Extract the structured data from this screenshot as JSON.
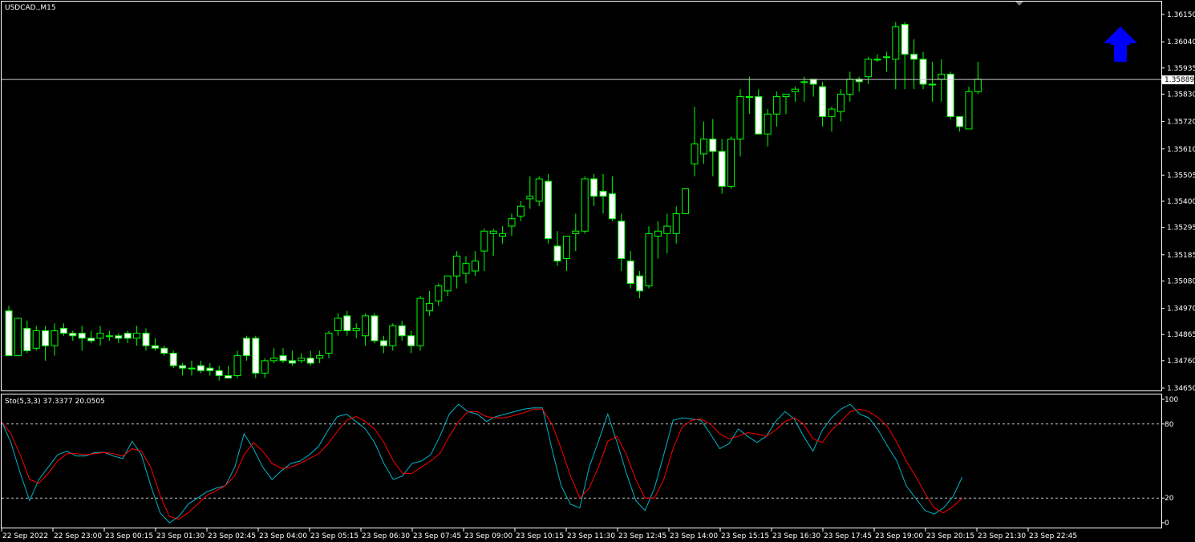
{
  "symbol_label": "USDCAD.,M15",
  "indicator_label": "Sto(5,3,3) 37.3377 20.0505",
  "arrow": {
    "name": "up-arrow-icon",
    "color": "#0000ff"
  },
  "colors": {
    "background": "#000000",
    "candle_outline": "#00ff00",
    "bull_body": "#000000",
    "bear_body": "#ffffff",
    "main_line": "#00b4c8",
    "signal_line": "#ff0000",
    "level_line": "#c0c0c0",
    "frame": "#ffffff"
  },
  "chart_data": [
    {
      "type": "candlestick",
      "title": "USDCAD.,M15",
      "ylim": [
        1.346,
        1.362
      ],
      "y_ticks": [
        "1.36150",
        "1.36040",
        "1.35935",
        "1.35830",
        "1.35720",
        "1.35610",
        "1.35505",
        "1.35400",
        "1.35295",
        "1.35185",
        "1.35080",
        "1.34970",
        "1.34865",
        "1.34760",
        "1.34650"
      ],
      "current_price": "1.35889",
      "current_price_value": 1.35889,
      "x_ticks": [
        "22 Sep 2022",
        "22 Sep 23:00",
        "23 Sep 00:15",
        "23 Sep 01:30",
        "23 Sep 02:45",
        "23 Sep 04:00",
        "23 Sep 05:15",
        "23 Sep 06:30",
        "23 Sep 07:45",
        "23 Sep 09:00",
        "23 Sep 10:15",
        "23 Sep 11:30",
        "23 Sep 12:45",
        "23 Sep 14:00",
        "23 Sep 15:15",
        "23 Sep 16:30",
        "23 Sep 17:45",
        "23 Sep 19:00",
        "23 Sep 20:15",
        "23 Sep 21:30",
        "23 Sep 22:45"
      ],
      "x_tick_bar_index": [
        0,
        5,
        10,
        15,
        20,
        25,
        30,
        35,
        40,
        45,
        50,
        55,
        60,
        65,
        70,
        75,
        80,
        85,
        90,
        95,
        100
      ],
      "ohlc": [
        [
          1.3496,
          1.3498,
          1.3478,
          1.3478
        ],
        [
          1.3478,
          1.3493,
          1.3478,
          1.3493
        ],
        [
          1.3489,
          1.3492,
          1.3479,
          1.348
        ],
        [
          1.3481,
          1.349,
          1.348,
          1.3488
        ],
        [
          1.3488,
          1.349,
          1.3476,
          1.3482
        ],
        [
          1.3482,
          1.3491,
          1.3478,
          1.3488
        ],
        [
          1.3489,
          1.3491,
          1.3486,
          1.3487
        ],
        [
          1.3487,
          1.3488,
          1.3484,
          1.3486
        ],
        [
          1.3487,
          1.349,
          1.348,
          1.3485
        ],
        [
          1.3485,
          1.3488,
          1.3483,
          1.3484
        ],
        [
          1.3485,
          1.349,
          1.3482,
          1.3487
        ],
        [
          1.3486,
          1.3488,
          1.3484,
          1.3486
        ],
        [
          1.3486,
          1.3487,
          1.3483,
          1.3485
        ],
        [
          1.3487,
          1.3488,
          1.3483,
          1.3485
        ],
        [
          1.3485,
          1.349,
          1.3482,
          1.3487
        ],
        [
          1.3487,
          1.3489,
          1.348,
          1.3482
        ],
        [
          1.3482,
          1.3485,
          1.348,
          1.3481
        ],
        [
          1.3481,
          1.3482,
          1.3478,
          1.3479
        ],
        [
          1.3479,
          1.348,
          1.3473,
          1.3474
        ],
        [
          1.3474,
          1.3475,
          1.347,
          1.3473
        ],
        [
          1.3473,
          1.3476,
          1.347,
          1.3473
        ],
        [
          1.3474,
          1.3476,
          1.3471,
          1.3472
        ],
        [
          1.3473,
          1.3475,
          1.347,
          1.3472
        ],
        [
          1.3472,
          1.3474,
          1.3468,
          1.347
        ],
        [
          1.347,
          1.3474,
          1.3469,
          1.3469
        ],
        [
          1.347,
          1.348,
          1.3469,
          1.3478
        ],
        [
          1.3485,
          1.3486,
          1.3476,
          1.3478
        ],
        [
          1.3485,
          1.3486,
          1.3469,
          1.3471
        ],
        [
          1.3471,
          1.3477,
          1.3469,
          1.3476
        ],
        [
          1.3476,
          1.3481,
          1.3475,
          1.3477
        ],
        [
          1.3478,
          1.3481,
          1.3475,
          1.3476
        ],
        [
          1.3476,
          1.348,
          1.3474,
          1.3475
        ],
        [
          1.3476,
          1.3479,
          1.3475,
          1.3477
        ],
        [
          1.3477,
          1.348,
          1.3474,
          1.3475
        ],
        [
          1.3477,
          1.348,
          1.3475,
          1.3478
        ],
        [
          1.3479,
          1.3488,
          1.3477,
          1.3487
        ],
        [
          1.3488,
          1.3495,
          1.3486,
          1.3493
        ],
        [
          1.3494,
          1.3496,
          1.3486,
          1.3488
        ],
        [
          1.3488,
          1.3491,
          1.3485,
          1.3489
        ],
        [
          1.3486,
          1.3495,
          1.3482,
          1.3494
        ],
        [
          1.3494,
          1.3495,
          1.3483,
          1.3484
        ],
        [
          1.3484,
          1.3486,
          1.3479,
          1.3482
        ],
        [
          1.3482,
          1.3491,
          1.348,
          1.349
        ],
        [
          1.349,
          1.3492,
          1.3484,
          1.3486
        ],
        [
          1.3486,
          1.3488,
          1.3479,
          1.3482
        ],
        [
          1.3482,
          1.3502,
          1.348,
          1.3501
        ],
        [
          1.3496,
          1.3504,
          1.3494,
          1.3499
        ],
        [
          1.35,
          1.3507,
          1.3498,
          1.3506
        ],
        [
          1.3504,
          1.351,
          1.3502,
          1.351
        ],
        [
          1.351,
          1.352,
          1.3505,
          1.3518
        ],
        [
          1.3511,
          1.3518,
          1.3507,
          1.3515
        ],
        [
          1.3512,
          1.352,
          1.351,
          1.3516
        ],
        [
          1.352,
          1.3529,
          1.3512,
          1.3528
        ],
        [
          1.3527,
          1.3529,
          1.3518,
          1.3528
        ],
        [
          1.3526,
          1.353,
          1.3523,
          1.3527
        ],
        [
          1.353,
          1.3535,
          1.3526,
          1.3533
        ],
        [
          1.3534,
          1.354,
          1.3532,
          1.3538
        ],
        [
          1.3541,
          1.355,
          1.3537,
          1.3542
        ],
        [
          1.354,
          1.355,
          1.3538,
          1.3549
        ],
        [
          1.3548,
          1.3551,
          1.3523,
          1.3525
        ],
        [
          1.3522,
          1.3528,
          1.3514,
          1.3516
        ],
        [
          1.3517,
          1.3525,
          1.3512,
          1.3526
        ],
        [
          1.3527,
          1.3535,
          1.352,
          1.3528
        ],
        [
          1.3528,
          1.355,
          1.3527,
          1.3549
        ],
        [
          1.3549,
          1.3551,
          1.3538,
          1.3542
        ],
        [
          1.3544,
          1.3551,
          1.3535,
          1.3542
        ],
        [
          1.3543,
          1.355,
          1.3532,
          1.3533
        ],
        [
          1.3532,
          1.3535,
          1.3512,
          1.3517
        ],
        [
          1.3516,
          1.352,
          1.3505,
          1.3507
        ],
        [
          1.351,
          1.3512,
          1.3501,
          1.3504
        ],
        [
          1.3506,
          1.353,
          1.3505,
          1.3527
        ],
        [
          1.3526,
          1.3532,
          1.3517,
          1.3528
        ],
        [
          1.3527,
          1.3535,
          1.3519,
          1.353
        ],
        [
          1.3527,
          1.3538,
          1.3523,
          1.3535
        ],
        [
          1.3535,
          1.3545,
          1.3535,
          1.3545
        ],
        [
          1.3555,
          1.3578,
          1.355,
          1.3563
        ],
        [
          1.3559,
          1.3572,
          1.3555,
          1.3565
        ],
        [
          1.3565,
          1.3573,
          1.355,
          1.356
        ],
        [
          1.356,
          1.3565,
          1.3543,
          1.3546
        ],
        [
          1.3546,
          1.3566,
          1.3545,
          1.3565
        ],
        [
          1.3565,
          1.3585,
          1.3558,
          1.3582
        ],
        [
          1.3582,
          1.359,
          1.3575,
          1.3582
        ],
        [
          1.3582,
          1.3585,
          1.3567,
          1.3567
        ],
        [
          1.3567,
          1.3577,
          1.3562,
          1.3575
        ],
        [
          1.3575,
          1.3584,
          1.357,
          1.3582
        ],
        [
          1.3582,
          1.3583,
          1.3575,
          1.3583
        ],
        [
          1.3584,
          1.3586,
          1.358,
          1.3585
        ],
        [
          1.3588,
          1.359,
          1.358,
          1.3588
        ],
        [
          1.3589,
          1.3589,
          1.3582,
          1.3587
        ],
        [
          1.3586,
          1.3588,
          1.357,
          1.3574
        ],
        [
          1.3574,
          1.3578,
          1.3568,
          1.3577
        ],
        [
          1.3576,
          1.3585,
          1.3572,
          1.3583
        ],
        [
          1.3583,
          1.3592,
          1.358,
          1.3589
        ],
        [
          1.3589,
          1.359,
          1.3584,
          1.3588
        ],
        [
          1.359,
          1.3598,
          1.3587,
          1.3597
        ],
        [
          1.3597,
          1.3599,
          1.3596,
          1.3597
        ],
        [
          1.3598,
          1.36,
          1.3592,
          1.3598
        ],
        [
          1.3597,
          1.3612,
          1.3585,
          1.361
        ],
        [
          1.3611,
          1.3612,
          1.3585,
          1.3599
        ],
        [
          1.3599,
          1.3605,
          1.3585,
          1.3597
        ],
        [
          1.3597,
          1.36,
          1.3585,
          1.3587
        ],
        [
          1.3587,
          1.3596,
          1.358,
          1.3587
        ],
        [
          1.3589,
          1.3597,
          1.358,
          1.3591
        ],
        [
          1.3591,
          1.3592,
          1.3573,
          1.3574
        ],
        [
          1.3574,
          1.3574,
          1.3568,
          1.357
        ],
        [
          1.3569,
          1.3586,
          1.3569,
          1.3584
        ],
        [
          1.3584,
          1.3596,
          1.3583,
          1.3589
        ]
      ]
    },
    {
      "type": "line",
      "title": "Sto(5,3,3) 37.3377 20.0505",
      "ylim": [
        0,
        100
      ],
      "y_ticks": [
        "100",
        "80",
        "20",
        "0"
      ],
      "levels": [
        80,
        20
      ],
      "series": [
        {
          "values": [
            82,
            65,
            40,
            18,
            35,
            45,
            55,
            58,
            54,
            54,
            57,
            57,
            54,
            52,
            66,
            55,
            30,
            8,
            0,
            5,
            15,
            20,
            25,
            28,
            30,
            45,
            72,
            60,
            45,
            35,
            42,
            48,
            50,
            55,
            62,
            75,
            86,
            88,
            82,
            76,
            65,
            48,
            35,
            38,
            48,
            50,
            55,
            70,
            88,
            96,
            90,
            88,
            82,
            86,
            88,
            90,
            92,
            93,
            93,
            60,
            30,
            15,
            12,
            45,
            66,
            88,
            65,
            40,
            18,
            10,
            28,
            55,
            83,
            85,
            84,
            83,
            72,
            60,
            64,
            76,
            70,
            65,
            70,
            82,
            90,
            84,
            70,
            58,
            75,
            85,
            92,
            96,
            88,
            85,
            75,
            62,
            50,
            30,
            20,
            10,
            7,
            12,
            21,
            37
          ]
        },
        {
          "values": [
            82,
            72,
            55,
            35,
            32,
            40,
            50,
            56,
            56,
            55,
            56,
            57,
            56,
            54,
            60,
            58,
            45,
            22,
            5,
            3,
            8,
            15,
            22,
            26,
            30,
            38,
            55,
            65,
            58,
            48,
            44,
            45,
            48,
            52,
            56,
            64,
            74,
            83,
            86,
            82,
            76,
            65,
            50,
            40,
            40,
            45,
            50,
            56,
            70,
            82,
            90,
            90,
            86,
            85,
            85,
            87,
            89,
            92,
            92,
            80,
            60,
            38,
            20,
            28,
            45,
            66,
            70,
            55,
            35,
            20,
            20,
            35,
            60,
            78,
            83,
            84,
            80,
            72,
            68,
            70,
            73,
            72,
            70,
            75,
            82,
            85,
            80,
            68,
            65,
            75,
            82,
            90,
            92,
            90,
            85,
            78,
            65,
            50,
            38,
            24,
            12,
            8,
            13,
            20
          ]
        }
      ]
    }
  ]
}
